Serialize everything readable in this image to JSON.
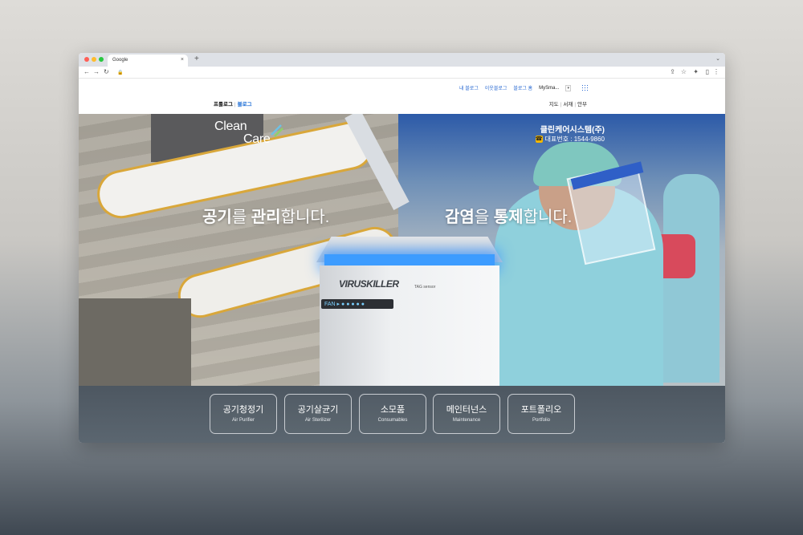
{
  "browser": {
    "tab_title": "Google",
    "tab_close": "×",
    "new_tab": "+",
    "tabbar_chevron": "⌄",
    "nav_back": "←",
    "nav_forward": "→",
    "nav_reload": "↻",
    "nav_lock": "🔒",
    "tools": {
      "share": "⇪",
      "star": "☆",
      "extensions": "✦",
      "sidepanel": "▯",
      "menu": "⋮"
    }
  },
  "site": {
    "top_links": [
      "내 블로그",
      "이웃블로그",
      "블로그 홈"
    ],
    "user_name": "MySma...",
    "user_caret": "▾",
    "blog_tabs": {
      "prologue": "프롤로그",
      "blog": "블로그"
    },
    "map_menu": {
      "map": "지도",
      "books": "서재",
      "guestbook": "안부"
    }
  },
  "hero": {
    "logo_line1": "Clean",
    "logo_line2": "Care",
    "company_name": "클린케어시스템(주)",
    "phone_icon": "☎",
    "phone_text": "대표번호 : 1544-9860",
    "slogan_left": {
      "strong1": "공기",
      "mid1": "를 ",
      "strong2": "관리",
      "end": "합니다."
    },
    "slogan_right": {
      "strong1": "감염",
      "mid1": "을 ",
      "strong2": "통제",
      "end": "합니다."
    },
    "device_brand": "VIRUSKILLER",
    "device_panel": "FAN ▸ ● ● ● ● ●",
    "device_sensor": "TAG sensor"
  },
  "menu": [
    {
      "ko": "공기청정기",
      "en": "Air Purifier"
    },
    {
      "ko": "공기살균기",
      "en": "Air Sterilizer"
    },
    {
      "ko": "소모품",
      "en": "Consumables"
    },
    {
      "ko": "메인터넌스",
      "en": "Maintenance"
    },
    {
      "ko": "포트폴리오",
      "en": "Portfolio"
    }
  ],
  "colors": {
    "accent": "#1f6fd6",
    "menu_bg": "#4d5761",
    "glow": "#3d9cff"
  }
}
